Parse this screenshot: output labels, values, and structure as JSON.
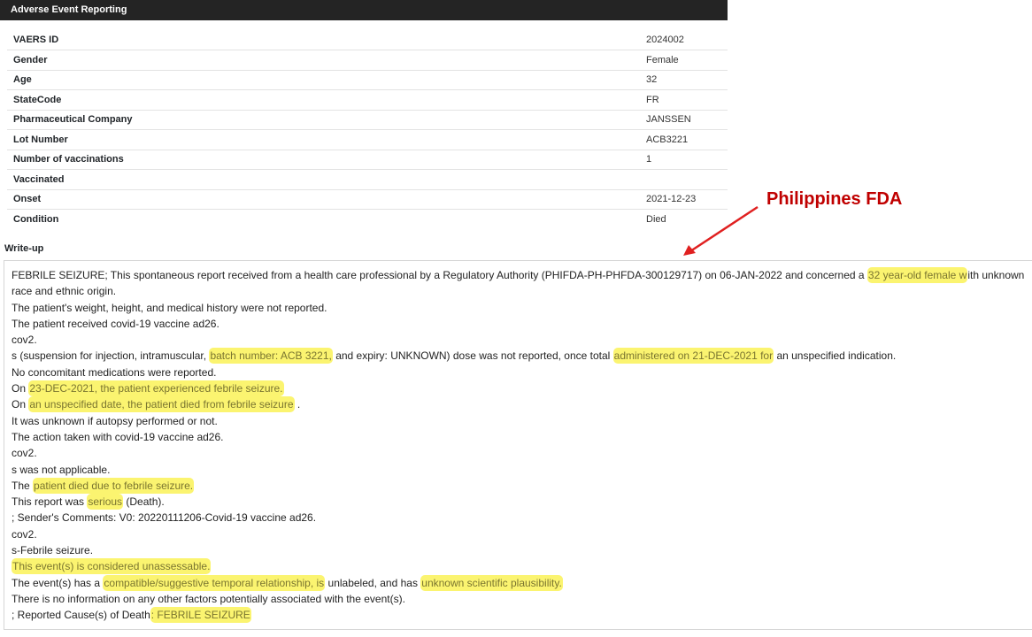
{
  "header": {
    "title": "Adverse Event Reporting"
  },
  "fields": [
    {
      "label": "VAERS ID",
      "value": "2024002"
    },
    {
      "label": "Gender",
      "value": "Female"
    },
    {
      "label": "Age",
      "value": "32"
    },
    {
      "label": "StateCode",
      "value": "FR"
    },
    {
      "label": "Pharmaceutical Company",
      "value": "JANSSEN"
    },
    {
      "label": "Lot Number",
      "value": "ACB3221"
    },
    {
      "label": "Number of vaccinations",
      "value": "1"
    },
    {
      "label": "Vaccinated",
      "value": ""
    },
    {
      "label": "Onset",
      "value": "2021-12-23"
    },
    {
      "label": "Condition",
      "value": "Died"
    }
  ],
  "writeup": {
    "label": "Write-up",
    "lines": [
      [
        {
          "t": "FEBRILE SEIZURE; This spontaneous report received from a health care professional by a Regulatory Authority (PHIFDA-PH-PHFDA-300129717) on 06-JAN-2022 and concerned a "
        },
        {
          "t": "32 year-old female w",
          "hl": true
        },
        {
          "t": "ith unknown"
        }
      ],
      [
        {
          "t": "race and ethnic origin."
        }
      ],
      [
        {
          "t": "The patient's weight, height, and medical history were not reported."
        }
      ],
      [
        {
          "t": "The patient received covid-19 vaccine ad26."
        }
      ],
      [
        {
          "t": "cov2."
        }
      ],
      [
        {
          "t": "s (suspension for injection, intramuscular, "
        },
        {
          "t": "batch number: ACB 3221,",
          "hl": true
        },
        {
          "t": " and expiry: UNKNOWN) dose was not reported, once total "
        },
        {
          "t": "administered on 21-DEC-2021 for",
          "hl": true
        },
        {
          "t": " an unspecified indication."
        }
      ],
      [
        {
          "t": "No concomitant medications were reported."
        }
      ],
      [
        {
          "t": "On "
        },
        {
          "t": "23-DEC-2021, the patient experienced febrile seizure.",
          "hl": true
        }
      ],
      [
        {
          "t": "On "
        },
        {
          "t": "an unspecified date, the patient died from febrile seizure",
          "hl": true
        },
        {
          "t": " ."
        }
      ],
      [
        {
          "t": "It was unknown if autopsy performed or not."
        }
      ],
      [
        {
          "t": "The action taken with covid-19 vaccine ad26."
        }
      ],
      [
        {
          "t": "cov2."
        }
      ],
      [
        {
          "t": "s was not applicable."
        }
      ],
      [
        {
          "t": "The "
        },
        {
          "t": "patient died due to febrile seizure.",
          "hl": true
        }
      ],
      [
        {
          "t": "This report was "
        },
        {
          "t": "serious",
          "hl": true
        },
        {
          "t": " (Death)."
        }
      ],
      [
        {
          "t": "; Sender's Comments: V0: 20220111206-Covid-19 vaccine ad26."
        }
      ],
      [
        {
          "t": "cov2."
        }
      ],
      [
        {
          "t": "s-Febrile seizure."
        }
      ],
      [
        {
          "t": "This event(s) is considered unassessable.",
          "hl": true
        }
      ],
      [
        {
          "t": "The event(s) has a "
        },
        {
          "t": "compatible/suggestive temporal relationship, is",
          "hl": true
        },
        {
          "t": " unlabeled, and has "
        },
        {
          "t": "unknown scientific plausibility.",
          "hl": true
        }
      ],
      [
        {
          "t": "There is no information on any other factors potentially associated with the event(s)."
        }
      ],
      [
        {
          "t": "; Reported Cause(s) of Death"
        },
        {
          "t": ": FEBRILE SEIZURE",
          "hl": true
        }
      ]
    ]
  },
  "annotation": {
    "text": "Philippines FDA",
    "color": "#c00000"
  },
  "colors": {
    "highlight": "#fbf470",
    "header_bg": "#242424"
  }
}
